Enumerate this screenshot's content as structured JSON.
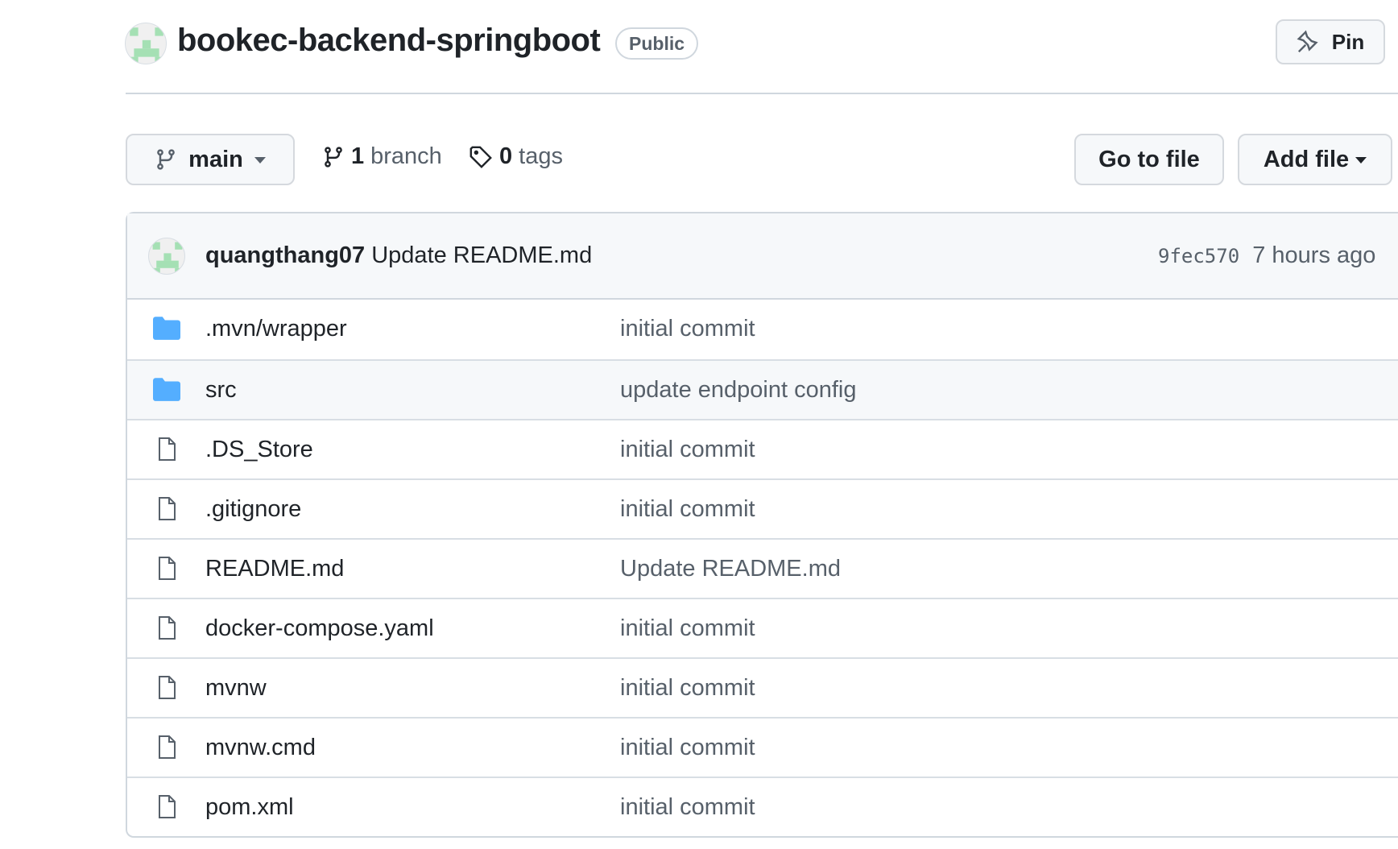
{
  "repo": {
    "name": "bookec-backend-springboot",
    "visibility": "Public",
    "pin_label": "Pin"
  },
  "toolbar": {
    "branch": "main",
    "branch_count": "1",
    "branch_label": "branch",
    "tag_count": "0",
    "tag_label": "tags",
    "goto_file": "Go to file",
    "add_file": "Add file"
  },
  "commit": {
    "author": "quangthang07",
    "message": "Update README.md",
    "sha": "9fec570",
    "time": "7 hours ago"
  },
  "files": [
    {
      "name": ".mvn/wrapper",
      "type": "folder",
      "message": "initial commit"
    },
    {
      "name": "src",
      "type": "folder",
      "message": "update endpoint config"
    },
    {
      "name": ".DS_Store",
      "type": "file",
      "message": "initial commit"
    },
    {
      "name": ".gitignore",
      "type": "file",
      "message": "initial commit"
    },
    {
      "name": "README.md",
      "type": "file",
      "message": "Update README.md"
    },
    {
      "name": "docker-compose.yaml",
      "type": "file",
      "message": "initial commit"
    },
    {
      "name": "mvnw",
      "type": "file",
      "message": "initial commit"
    },
    {
      "name": "mvnw.cmd",
      "type": "file",
      "message": "initial commit"
    },
    {
      "name": "pom.xml",
      "type": "file",
      "message": "initial commit"
    }
  ],
  "colors": {
    "folder": "#54aeff",
    "avatar": "#a5e0b4"
  }
}
